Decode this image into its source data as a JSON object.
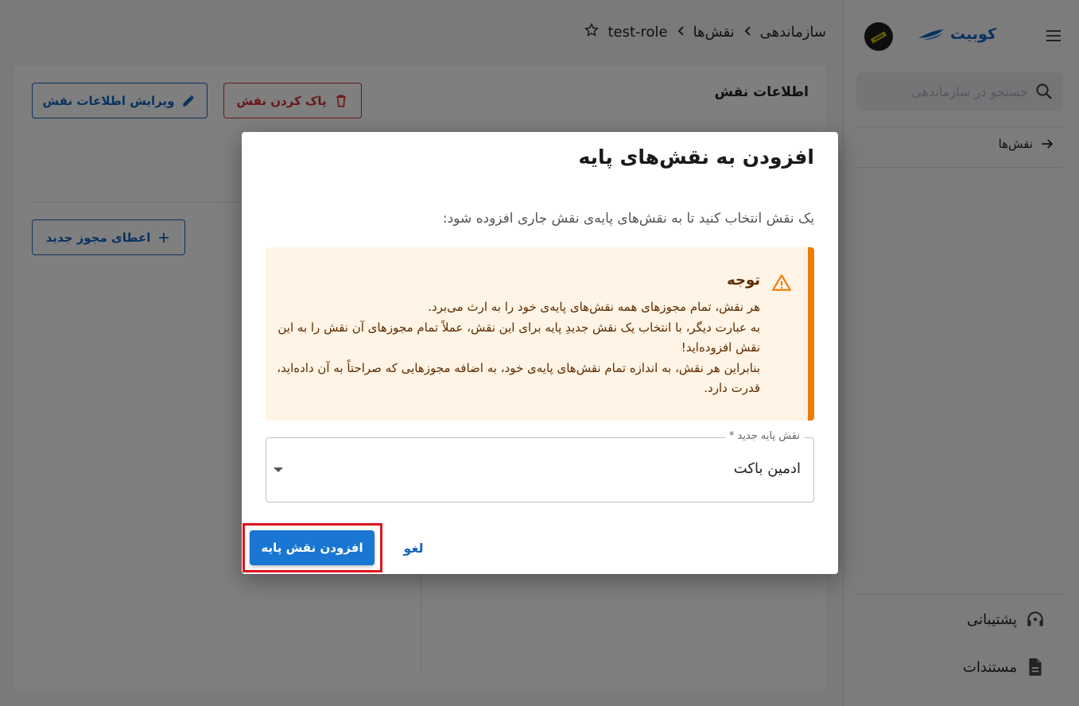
{
  "sidebar": {
    "brand_name": "کوبیت",
    "search_placeholder": "جستجو در سازماندهی",
    "nav_items": [
      {
        "label": "نقش‌ها"
      }
    ],
    "bottom_items": [
      {
        "label": "پشتیبانی"
      },
      {
        "label": "مستندات"
      }
    ]
  },
  "breadcrumb": {
    "items": [
      "سازماندهی",
      "نقش‌ها",
      "test-role"
    ]
  },
  "main": {
    "section_title": "اطلاعات نقش",
    "edit_button_label": "ویرایش اطلاعات نقش",
    "delete_button_label": "پاک کردن نقش",
    "grant_button_label": "اعطای مجوز جدید"
  },
  "dialog": {
    "title": "افزودن به نقش‌های پایه",
    "description": "یک نقش انتخاب کنید تا به نقش‌های پایه‌ی نقش جاری افزوده شود:",
    "alert": {
      "title": "توجه",
      "lines": [
        "هر نقش، تمام مجوزهای همه نقش‌های پایه‌ی خود را به ارث می‌برد.",
        "به عبارت دیگر، با انتخاب یک نقش جدیدِ پایه برای این نقش، عملاً تمام مجوزهای آن نقش را به این نقش افزوده‌اید!",
        "بنابراین هر نقش، به اندازه تمام نقش‌های پایه‌ی خود، به اضافه مجوزهایی که صراحتاً به آن داده‌اید، قدرت دارد."
      ]
    },
    "select": {
      "label": "نقش پایه جدید *",
      "value": "ادمین باکت"
    },
    "submit_label": "افزودن نقش پایه",
    "cancel_label": "لغو"
  },
  "colors": {
    "primary": "#1976d2",
    "danger": "#d32f2f",
    "warning_accent": "#ef7c00",
    "warning_bg": "#fff4e5",
    "highlight": "#e2141c"
  }
}
